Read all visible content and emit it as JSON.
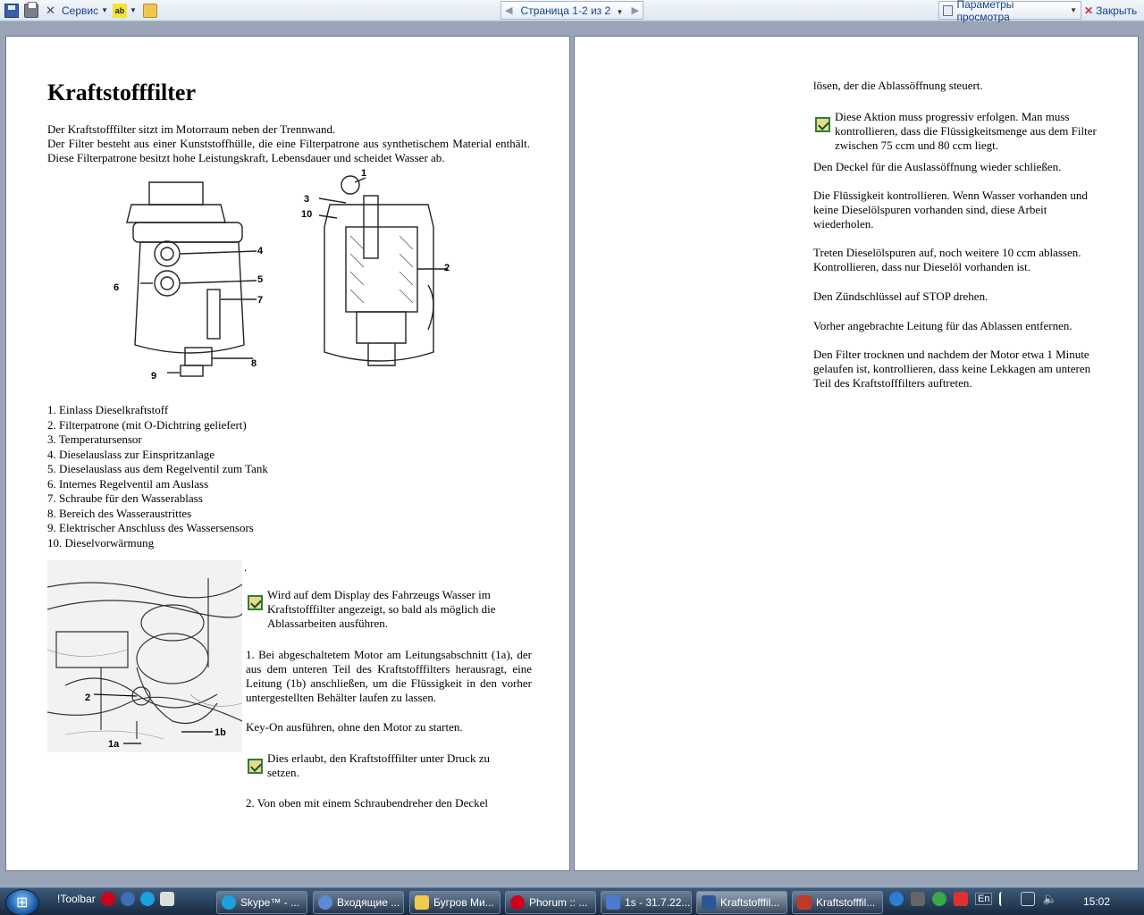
{
  "toolbar": {
    "service_label": "Сервис",
    "page_indicator": "Страница 1-2 из 2",
    "view_options_label": "Параметры просмотра",
    "close_label": "Закрыть"
  },
  "page1": {
    "title": "Kraftstofffilter",
    "intro": [
      "Der Kraftstofffilter sitzt im Motorraum neben der Trennwand.",
      "Der Filter besteht aus einer Kunststoffhülle, die eine Filterpatrone aus synthetischem Material enthält. Diese Filterpatrone besitzt hohe Leistungskraft, Lebensdauer und scheidet Wasser ab."
    ],
    "diagram_callouts": [
      "1",
      "2",
      "3",
      "4",
      "5",
      "6",
      "7",
      "8",
      "9",
      "10"
    ],
    "legend": [
      "1. Einlass Dieselkraftstoff",
      "2. Filterpatrone (mit O-Dichtring geliefert)",
      "3. Temperatursensor",
      "4. Dieselauslass zur Einspritzanlage",
      "5. Dieselauslass aus dem Regelventil zum Tank",
      "6. Internes Regelventil am Auslass",
      "7. Schraube für den Wasserablass",
      "8. Bereich des Wasseraustrittes",
      "9. Elektrischer Anschluss des Wassersensors",
      "10. Dieselvorwärmung"
    ],
    "photo_callouts": [
      "2",
      "1a",
      "1b"
    ],
    "dot": ".",
    "note1": "Wird auf dem Display des Fahrzeugs Wasser im Kraftstofffilter angezeigt, so bald als möglich die Ablassarbeiten ausführen.",
    "step1": "1. Bei abgeschaltetem Motor am Leitungsabschnitt (1a), der aus dem unteren Teil des Kraftstofffilters herausragt, eine Leitung (1b) anschließen, um die Flüssigkeit in den vorher untergestellten Behälter laufen zu lassen.",
    "keyon": "Key-On ausführen, ohne den Motor zu starten.",
    "note2": "Dies erlaubt, den Kraftstofffilter unter Druck zu setzen.",
    "step2": "2. Von oben mit einem Schraubendreher den Deckel"
  },
  "page2": {
    "p1": "lösen, der die Ablassöffnung steuert.",
    "note": "Diese Aktion muss progressiv erfolgen. Man muss kontrollieren, dass die Flüssigkeitsmenge aus dem Filter zwischen 75 ccm und 80 ccm liegt.",
    "p2": "Den Deckel für die Auslassöffnung wieder schließen.",
    "p3": "Die Flüssigkeit kontrollieren. Wenn Wasser vorhanden und keine Dieselölspuren vorhanden sind, diese Arbeit wiederholen.",
    "p4": "Treten Dieselölspuren auf, noch weitere 10 ccm ablassen. Kontrollieren, dass nur Dieselöl vorhanden ist.",
    "p5": "Den Zündschlüssel auf STOP drehen.",
    "p6": "Vorher angebrachte Leitung für das Ablassen entfernen.",
    "p7": "Den Filter trocknen und nachdem der Motor etwa 1 Minute gelaufen ist, kontrollieren, dass keine Lekkagen am unteren Teil des Kraftstofffilters auftreten."
  },
  "taskbar": {
    "toolbar_label": "!Toolbar",
    "tasks": [
      {
        "label": "Skype™ - ...",
        "color": "#1ba1e2"
      },
      {
        "label": "Входящие ...",
        "color": "#5b8bd6"
      },
      {
        "label": "Бугров Ми...",
        "color": "#f2c94c"
      },
      {
        "label": "Phorum :: ...",
        "color": "#d0021b"
      },
      {
        "label": "1s - 31.7.22...",
        "color": "#4a7bd0"
      },
      {
        "label": "Kraftstofffil...",
        "color": "#2b5797"
      },
      {
        "label": "Kraftstofffil...",
        "color": "#c0392b"
      }
    ],
    "language": "En",
    "clock": "15:02"
  }
}
